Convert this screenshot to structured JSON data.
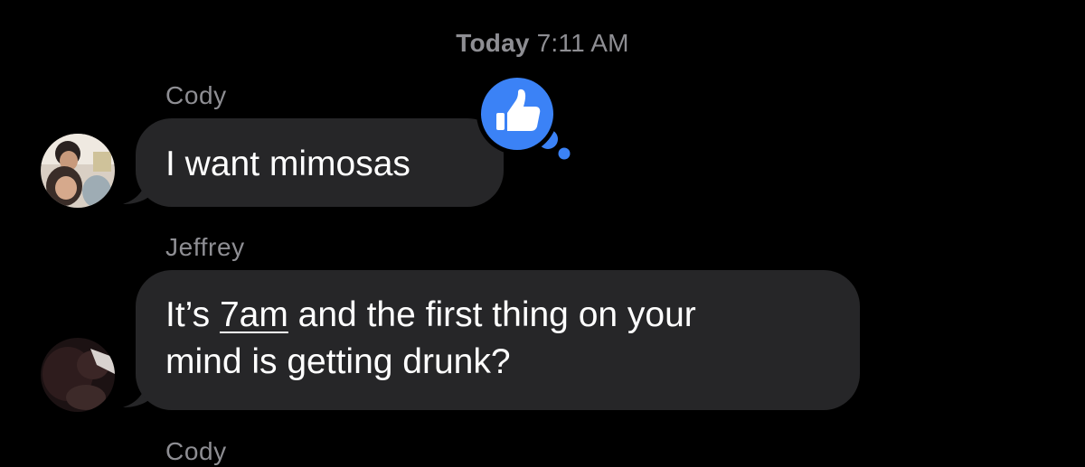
{
  "conversation": {
    "timestamp_day": "Today",
    "timestamp_time": "7:11 AM",
    "messages": [
      {
        "sender": "Cody",
        "text": "I want mimosas",
        "tapback": "thumbs-up-icon"
      },
      {
        "sender": "Jeffrey",
        "text_before_link": "It’s ",
        "link_text": "7am",
        "text_after_link_line1": " and the first thing on your",
        "text_line2": "mind is getting drunk?"
      },
      {
        "sender": "Cody"
      }
    ]
  },
  "colors": {
    "background": "#000000",
    "bubble": "#262628",
    "meta_text": "#8e8e93",
    "tapback_blue": "#3b82f6"
  }
}
